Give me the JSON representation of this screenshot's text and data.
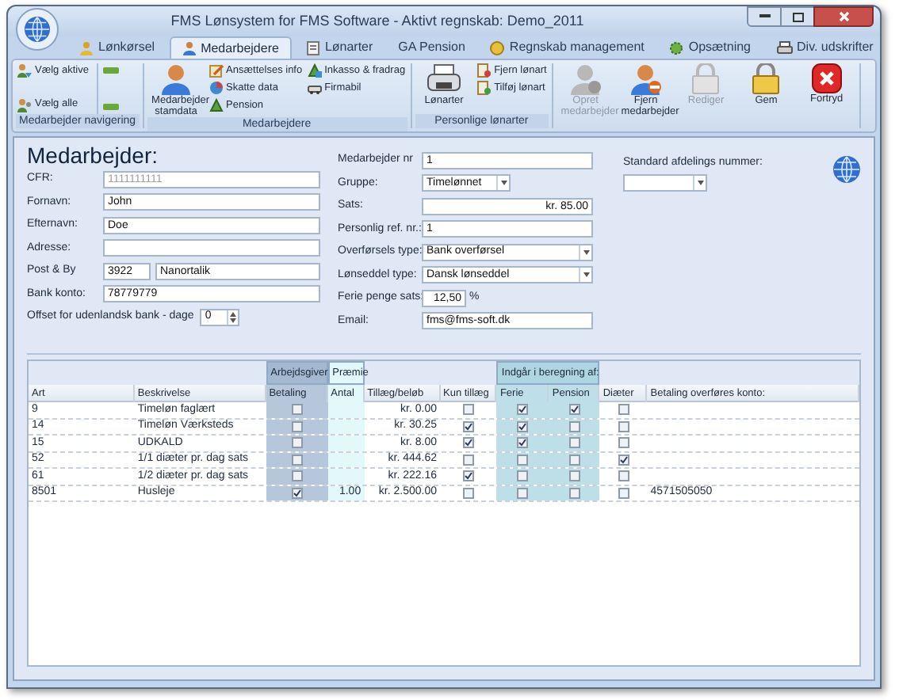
{
  "window": {
    "title": "FMS Lønsystem for FMS Software - Aktivt regnskab: Demo_2011"
  },
  "tabs": [
    {
      "label": "Lønkørsel",
      "selected": false
    },
    {
      "label": "Medarbejdere",
      "selected": true
    },
    {
      "label": "Lønarter",
      "selected": false
    },
    {
      "label": "GA Pension",
      "selected": false
    },
    {
      "label": "Regnskab management",
      "selected": false
    },
    {
      "label": "Opsætning",
      "selected": false
    },
    {
      "label": "Div. udskrifter",
      "selected": false
    }
  ],
  "ribbon": [
    {
      "label": "Medarbejder navigering",
      "buttons": [
        {
          "kind": "small",
          "label": "Vælg aktive",
          "disabled": false
        },
        {
          "kind": "small",
          "label": "Vælg alle",
          "disabled": false
        },
        {
          "kind": "arrow",
          "disabled": false
        },
        {
          "kind": "arrow",
          "disabled": false
        }
      ]
    },
    {
      "label": "Medarbejdere",
      "buttons": [
        {
          "kind": "large",
          "label": "Medarbejder stamdata",
          "disabled": false
        },
        {
          "kind": "small",
          "label": "Ansættelses info",
          "disabled": false
        },
        {
          "kind": "small",
          "label": "Skatte data",
          "disabled": false
        },
        {
          "kind": "small",
          "label": "Pension",
          "disabled": false
        },
        {
          "kind": "small",
          "label": "Inkasso & fradrag",
          "disabled": false
        },
        {
          "kind": "small",
          "label": "Firmabil",
          "disabled": false
        }
      ]
    },
    {
      "label": "Personlige lønarter",
      "buttons": [
        {
          "kind": "large",
          "label": "Lønarter",
          "disabled": false
        },
        {
          "kind": "small",
          "label": "Fjern lønart",
          "disabled": false
        },
        {
          "kind": "small",
          "label": "Tilføj lønart",
          "disabled": false
        }
      ]
    },
    {
      "buttons": [
        {
          "kind": "large",
          "label": "Opret medarbejder",
          "disabled": true
        },
        {
          "kind": "large",
          "label": "Fjern medarbejder",
          "disabled": false
        },
        {
          "kind": "large",
          "label": "Rediger",
          "disabled": true
        },
        {
          "kind": "large",
          "label": "Gem",
          "disabled": false
        },
        {
          "kind": "large",
          "label": "Fortryd",
          "disabled": false
        }
      ]
    }
  ],
  "form": {
    "heading": "Medarbejder:",
    "left_fields": [
      {
        "label": "CFR:",
        "kind": "text",
        "value": "1111111111",
        "disabled": true
      },
      {
        "label": "Fornavn:",
        "kind": "text",
        "value": "John"
      },
      {
        "label": "Efternavn:",
        "kind": "text",
        "value": "Doe"
      },
      {
        "label": "Adresse:",
        "kind": "text"
      },
      {
        "label": "Post & By",
        "kind": "pair",
        "value": "3922",
        "second_value": "Nanortalik"
      },
      {
        "label": "Bank konto:",
        "kind": "text",
        "value": "78779779"
      },
      {
        "label": "Offset for udenlandsk bank - dage",
        "kind": "spinner",
        "value": "0"
      }
    ],
    "middle_fields": [
      {
        "label": "Medarbejder nr",
        "kind": "text",
        "value": "1"
      },
      {
        "label": "Gruppe:",
        "kind": "short_dropdown",
        "value": "Timelønnet"
      },
      {
        "label": "Sats:",
        "kind": "amount",
        "value": "kr. 85.00"
      },
      {
        "label": "Personlig ref. nr.:",
        "kind": "text",
        "value": "1"
      },
      {
        "label": "Overførsels type:",
        "kind": "dropdown",
        "value": "Bank overførsel"
      },
      {
        "label": "Lønseddel type:",
        "kind": "dropdown",
        "value": "Dansk lønseddel"
      },
      {
        "label": "Ferie penge sats:",
        "kind": "percent",
        "value": "12,50",
        "unit": "%"
      },
      {
        "label": "Email:",
        "kind": "text",
        "value": "fms@fms-soft.dk"
      }
    ],
    "department": {
      "label": "Standard afdelings nummer:"
    }
  },
  "table": {
    "columns": [
      {
        "label": "Art"
      },
      {
        "label": "Beskrivelse"
      },
      {
        "group": "Arbejdsgiver",
        "kind": "employer",
        "columns": [
          {
            "label": "Betaling"
          }
        ]
      },
      {
        "group": "Præmie",
        "kind": "bonus",
        "columns": [
          {
            "label": "Antal"
          }
        ]
      },
      {
        "label": "Tillæg/beløb"
      },
      {
        "label": "Kun tillæg"
      },
      {
        "group": "Indgår i beregning af:",
        "kind": "included",
        "columns": [
          {
            "label": "Ferie"
          },
          {
            "label": "Pension"
          }
        ]
      },
      {
        "label": "Diæter"
      },
      {
        "label": "Betaling overføres konto:"
      }
    ],
    "rows": [
      {
        "cells": [
          "9",
          "Timeløn faglært",
          {
            "checked": false
          },
          null,
          "kr. 0.00",
          {
            "checked": false
          },
          {
            "checked": true
          },
          {
            "checked": true
          },
          {
            "checked": false
          },
          null
        ]
      },
      {
        "cells": [
          "14",
          "Timeløn Værksteds",
          {
            "checked": false
          },
          null,
          "kr. 30.25",
          {
            "checked": true
          },
          {
            "checked": true
          },
          {
            "checked": false
          },
          {
            "checked": false
          },
          null
        ]
      },
      {
        "cells": [
          "15",
          "UDKALD",
          {
            "checked": false
          },
          null,
          "kr. 8.00",
          {
            "checked": true
          },
          {
            "checked": true
          },
          {
            "checked": false
          },
          {
            "checked": false
          },
          null
        ]
      },
      {
        "cells": [
          "52",
          "1/1 diæter pr. dag sats",
          {
            "checked": false
          },
          null,
          "kr. 444.62",
          {
            "checked": false
          },
          {
            "checked": false
          },
          {
            "checked": false
          },
          {
            "checked": true
          },
          null
        ]
      },
      {
        "cells": [
          "61",
          "1/2 diæter pr. dag sats",
          {
            "checked": false
          },
          null,
          "kr. 222.16",
          {
            "checked": true
          },
          {
            "checked": false
          },
          {
            "checked": false
          },
          {
            "checked": false
          },
          null
        ]
      },
      {
        "cells": [
          "8501",
          "Husleje",
          {
            "checked": true
          },
          "1.00",
          "kr. 2.500.00",
          {
            "checked": false
          },
          {
            "checked": false
          },
          {
            "checked": false
          },
          {
            "checked": false
          },
          "4571505050"
        ]
      }
    ]
  }
}
